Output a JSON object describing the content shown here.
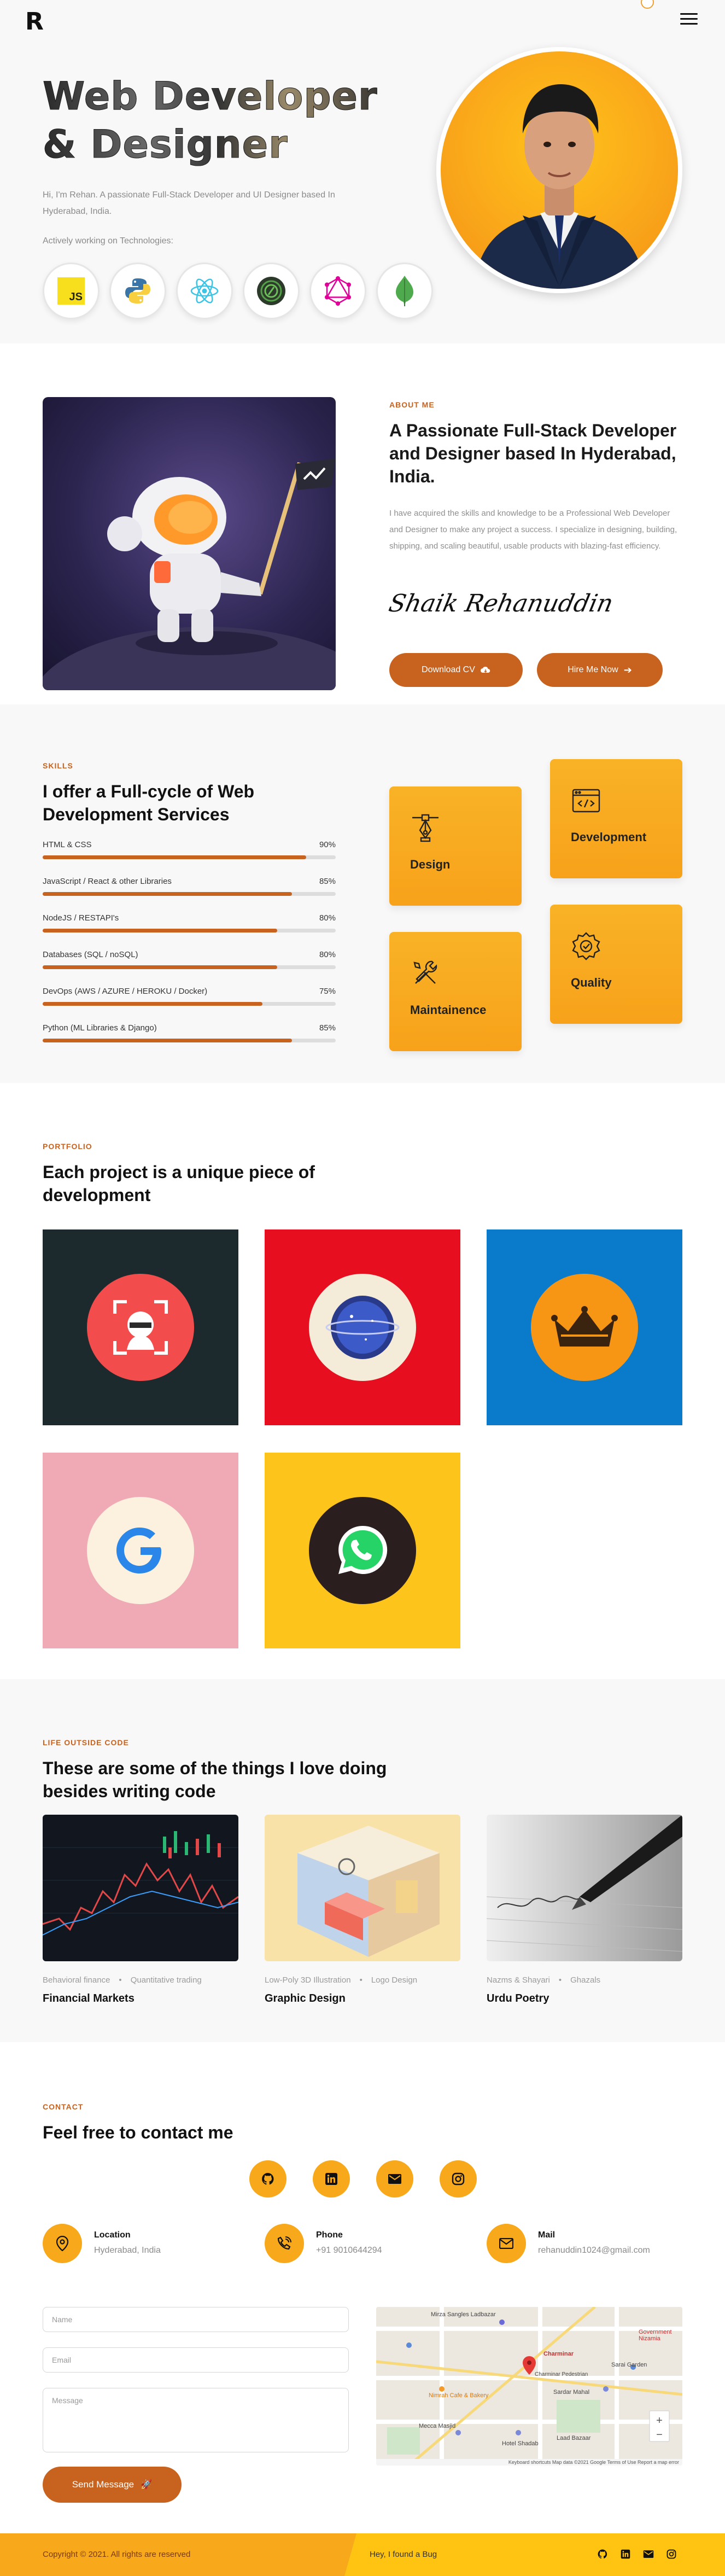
{
  "nav": {
    "logo": "R",
    "menu_icon": "menu-icon",
    "theme_toggle_icon": "theme-toggle-icon"
  },
  "hero": {
    "title_line1": "Web Developer",
    "title_line2": "& Designer",
    "intro": "Hi, I'm Rehan. A passionate Full-Stack Developer and UI Designer based In Hyderabad, India.",
    "tech_label": "Actively working on Technologies:",
    "techs": [
      "javascript-icon",
      "python-icon",
      "react-icon",
      "django-icon",
      "graphql-icon",
      "mongodb-icon"
    ],
    "techs_text": {
      "js": "JS"
    }
  },
  "about": {
    "label": "ABOUT ME",
    "title": "A Passionate Full-Stack Developer and Designer based In Hyderabad, India.",
    "description": "I have acquired the skills and knowledge to be a Professional Web Developer and Designer to make any project a success. I specialize in designing, building, shipping, and scaling beautiful, usable products with blazing-fast efficiency.",
    "signature": "Shaik Rehanuddin",
    "btn_cv": "Download CV",
    "btn_hire": "Hire Me Now"
  },
  "skills": {
    "label": "SKILLS",
    "title": "I offer a Full-cycle of Web Development Services",
    "items": [
      {
        "name": "HTML & CSS",
        "pct": "90%",
        "value": 0.9
      },
      {
        "name": "JavaScript / React & other Libraries",
        "pct": "85%",
        "value": 0.85
      },
      {
        "name": "NodeJS / RESTAPI's",
        "pct": "80%",
        "value": 0.8
      },
      {
        "name": "Databases (SQL / noSQL)",
        "pct": "80%",
        "value": 0.8
      },
      {
        "name": "DevOps (AWS / AZURE / HEROKU / Docker)",
        "pct": "75%",
        "value": 0.75
      },
      {
        "name": "Python (ML Libraries & Django)",
        "pct": "85%",
        "value": 0.85
      }
    ],
    "services": [
      "Design",
      "Development",
      "Maintainence",
      "Quality"
    ]
  },
  "portfolio": {
    "label": "PORTFOLIO",
    "title": "Each project is a unique piece of development",
    "colors": [
      "#1c2a2e",
      "#e60e1f",
      "#0a7acb",
      "#f0aab5",
      "#fdc51c"
    ]
  },
  "life": {
    "label": "LIFE OUTSIDE CODE",
    "title": "These are some of the things I love doing besides writing code",
    "cards": [
      {
        "tag1": "Behavioral finance",
        "tag2": "Quantitative trading",
        "name": "Financial Markets"
      },
      {
        "tag1": "Low-Poly 3D Illustration",
        "tag2": "Logo Design",
        "name": "Graphic Design"
      },
      {
        "tag1": "Nazms & Shayari",
        "tag2": "Ghazals",
        "name": "Urdu Poetry"
      }
    ]
  },
  "contact": {
    "label": "CONTACT",
    "title": "Feel free to contact me",
    "location_title": "Location",
    "location_val": "Hyderabad, India",
    "phone_title": "Phone",
    "phone_val": "+91 9010644294",
    "mail_title": "Mail",
    "mail_val": "rehanuddin1024@gmail.com",
    "name_placeholder": "Name",
    "email_placeholder": "Email",
    "message_placeholder": "Message",
    "send_label": "Send Message",
    "map": {
      "places": [
        "Mirza Sangles Ladbazar",
        "Charminar",
        "Nimrah Cafe & Bakery",
        "Charminar Pedestrian",
        "Mecca Masjid",
        "Sardar Mahal",
        "Laad Bazaar",
        "Sarai Garden",
        "Hotel Shadab",
        "Government Nizamia"
      ],
      "footer": "Keyboard shortcuts  Map data ©2021 Google  Terms of Use  Report a map error"
    }
  },
  "footer": {
    "copyright": "Copyright © 2021. All rights are reserved",
    "bug": "Hey, I found a Bug"
  },
  "colors": {
    "accent": "#c8621f",
    "yellow": "#f7a81b",
    "light_yellow": "#ffc312",
    "bg_light": "#f8f8f8"
  }
}
